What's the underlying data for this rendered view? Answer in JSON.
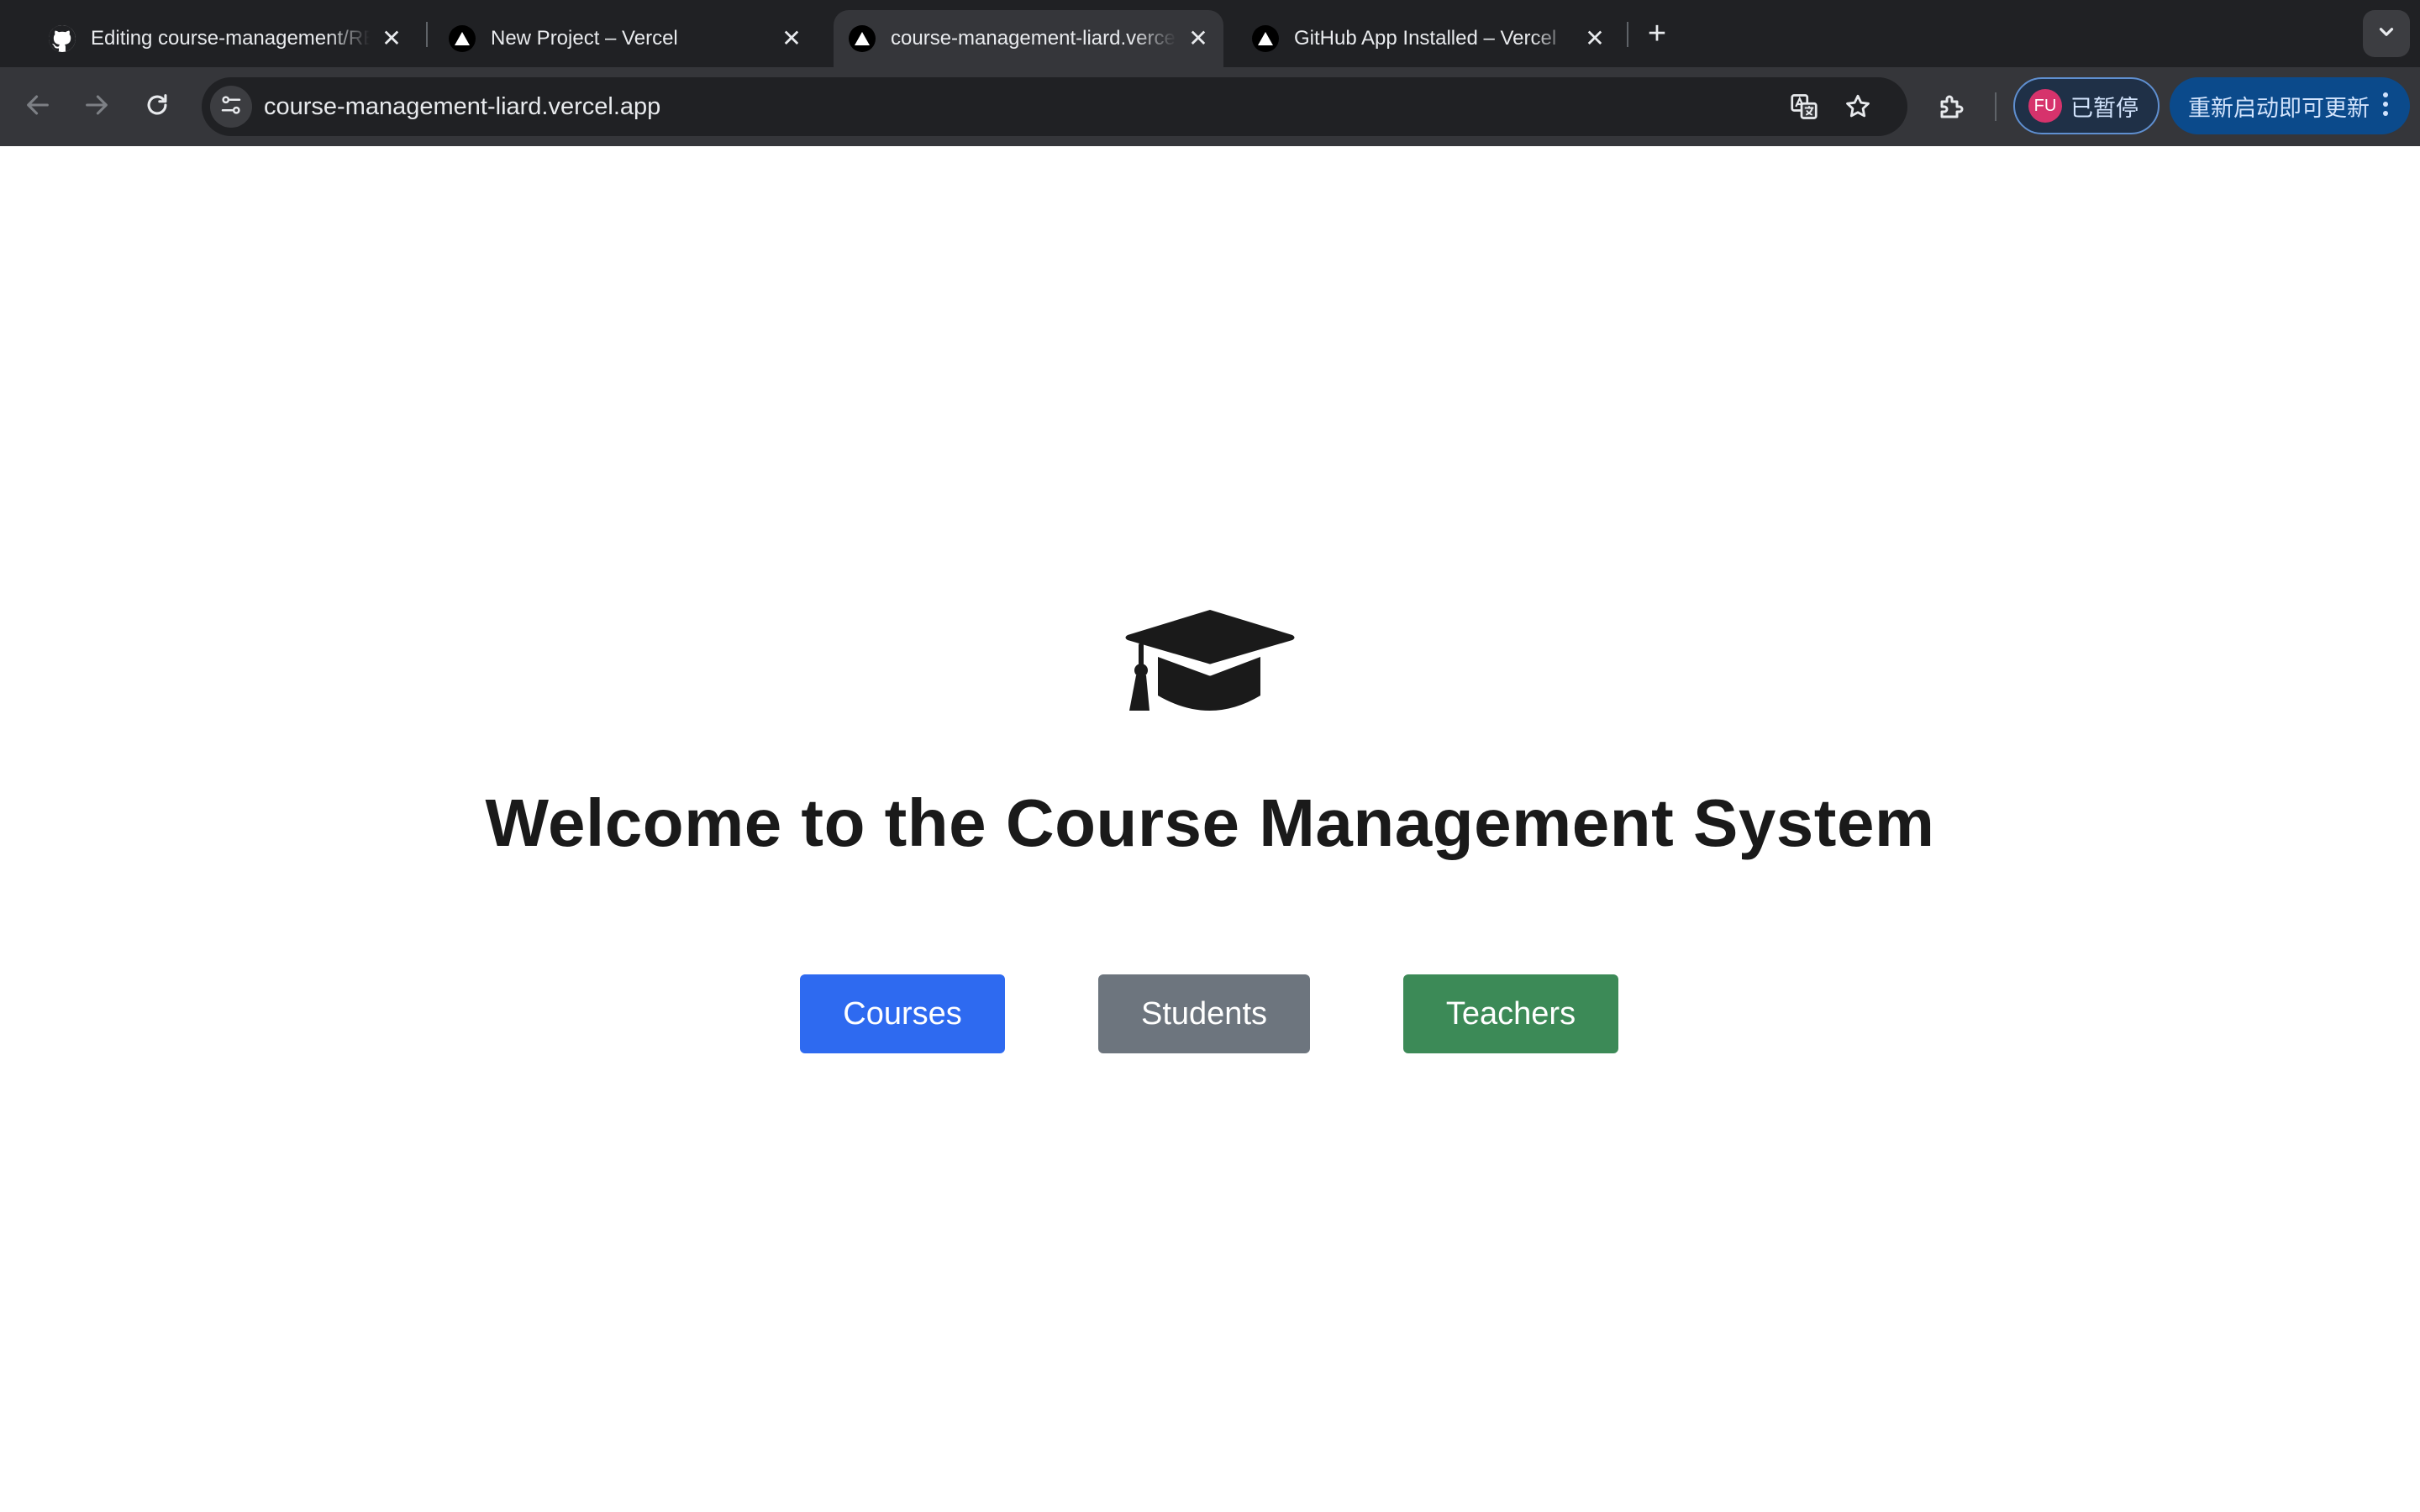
{
  "browser": {
    "tabs": [
      {
        "title": "Editing course-management/README.md",
        "favicon": "github-icon",
        "active": false
      },
      {
        "title": "New Project – Vercel",
        "favicon": "vercel-icon",
        "active": false
      },
      {
        "title": "course-management-liard.vercel.app",
        "favicon": "vercel-icon",
        "active": true
      },
      {
        "title": "GitHub App Installed – Vercel",
        "favicon": "vercel-icon",
        "active": false
      }
    ],
    "new_tab_label": "+",
    "url": "course-management-liard.vercel.app",
    "profile": {
      "initials": "FU",
      "status": "已暂停"
    },
    "update_label": "重新启动即可更新",
    "colors": {
      "tabstrip": "#202124",
      "toolbar": "#35363a",
      "update_chip": "#0b4a8b"
    }
  },
  "page": {
    "hero_icon": "graduation-cap-icon",
    "heading": "Welcome to the Course Management System",
    "buttons": [
      {
        "label": "Courses",
        "color": "#2e6af0"
      },
      {
        "label": "Students",
        "color": "#6d757e"
      },
      {
        "label": "Teachers",
        "color": "#3c8a57"
      }
    ]
  }
}
